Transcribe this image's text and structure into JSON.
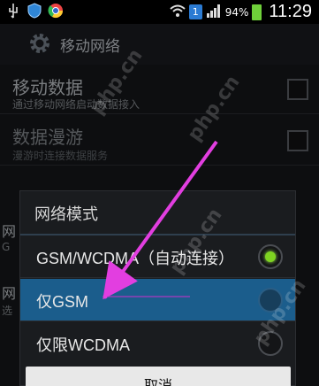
{
  "status_bar": {
    "left_icons": [
      "usb-icon",
      "shield-icon",
      "chrome-icon"
    ],
    "wifi_icon": "wifi-icon",
    "notification_badge": "1",
    "battery_percent": "94%",
    "time": "11:29"
  },
  "action_bar": {
    "title": "移动网络"
  },
  "settings": {
    "items": [
      {
        "title": "移动数据",
        "subtitle": "通过移动网络启动数据接入"
      },
      {
        "title": "数据漫游",
        "subtitle": "漫游时连接数据服务"
      },
      {
        "title": "",
        "subtitle": ""
      },
      {
        "title": "网",
        "subtitle": "G"
      },
      {
        "title": "网",
        "subtitle": "选"
      }
    ]
  },
  "dialog": {
    "title": "网络模式",
    "options": [
      {
        "label": "GSM/WCDMA（自动连接）",
        "checked": true
      },
      {
        "label": "仅GSM",
        "checked": false
      },
      {
        "label": "仅限WCDMA",
        "checked": false
      }
    ],
    "cancel_label": "取消"
  },
  "watermark": {
    "text": "php.cn"
  },
  "colors": {
    "accent_highlight": "#1b5d8c",
    "radio_checked": "#7ed321",
    "annotation_arrow": "#e23ee0"
  }
}
